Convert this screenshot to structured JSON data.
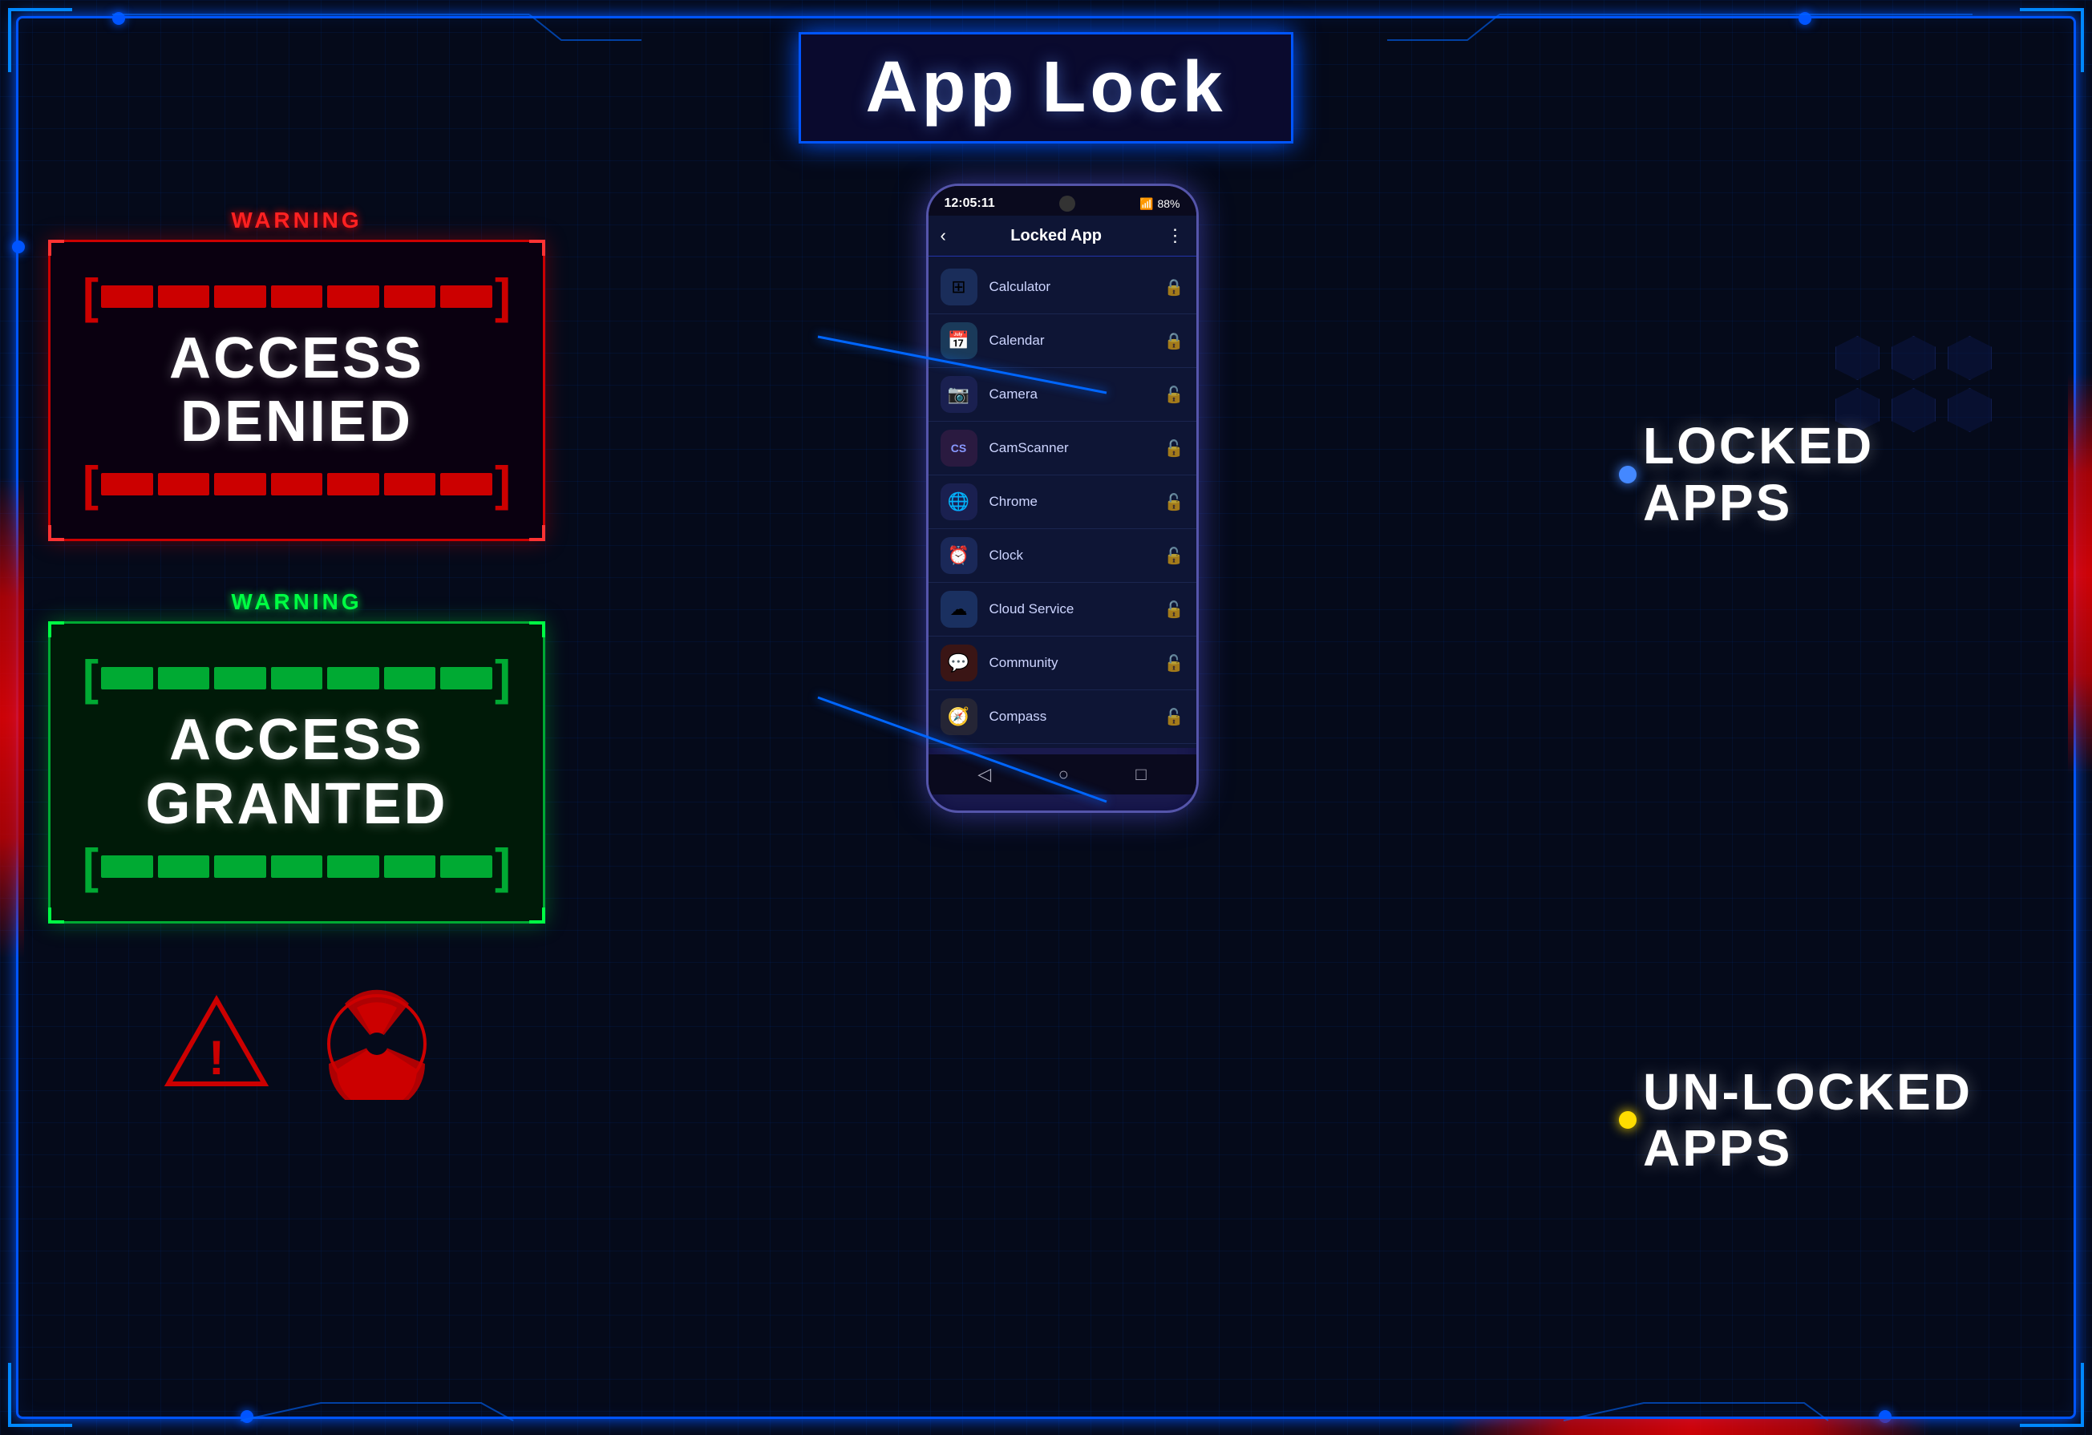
{
  "title": "App Lock",
  "left_panel": {
    "access_denied": {
      "warning_label": "WARNING",
      "text_line1": "ACCESS",
      "text_line2": "DENIED"
    },
    "access_granted": {
      "warning_label": "WARNING",
      "text_line1": "ACCESS",
      "text_line2": "GRANTED"
    }
  },
  "phone": {
    "time": "12:05:11",
    "battery": "88%",
    "header_title": "Locked App",
    "apps": [
      {
        "name": "Calculator",
        "icon": "⊞",
        "locked": true
      },
      {
        "name": "Calendar",
        "icon": "📅",
        "locked": true
      },
      {
        "name": "Camera",
        "icon": "📷",
        "locked": false
      },
      {
        "name": "CamScanner",
        "icon": "CS",
        "locked": false
      },
      {
        "name": "Chrome",
        "icon": "🌐",
        "locked": false
      },
      {
        "name": "Clock",
        "icon": "⏰",
        "locked": false
      },
      {
        "name": "Cloud Service",
        "icon": "☁",
        "locked": false
      },
      {
        "name": "Community",
        "icon": "💬",
        "locked": false
      },
      {
        "name": "Compass",
        "icon": "🧭",
        "locked": false
      }
    ]
  },
  "right_panel": {
    "locked_apps_label": "LOCKED\nAPPS",
    "unlocked_apps_label": "UN-LOCKED\nAPPS"
  }
}
